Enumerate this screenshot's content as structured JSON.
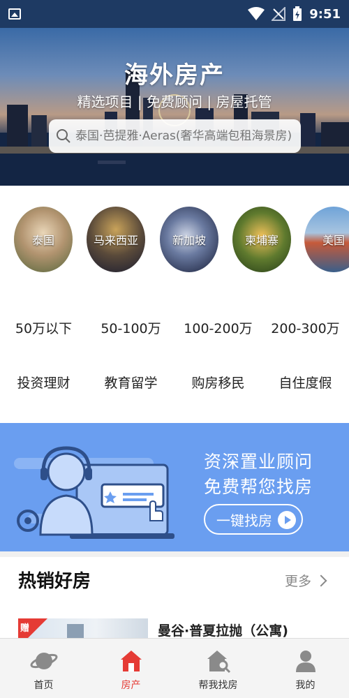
{
  "status_bar": {
    "time": "9:51",
    "icons": [
      "image-icon",
      "wifi-icon",
      "no-signal-icon",
      "battery-charging-icon"
    ]
  },
  "hero": {
    "title": "海外房产",
    "subtitle": "精选项目 | 免费顾问 | 房屋托管",
    "search_placeholder": "泰国·芭提雅·Aeras(奢华高端包租海景房)"
  },
  "countries": [
    {
      "label": "泰国"
    },
    {
      "label": "马来西亚"
    },
    {
      "label": "新加坡"
    },
    {
      "label": "柬埔寨"
    },
    {
      "label": "美国"
    }
  ],
  "price_filters": [
    "50万以下",
    "50-100万",
    "100-200万",
    "200-300万"
  ],
  "topic_filters": [
    "投资理财",
    "教育留学",
    "购房移民",
    "自住度假"
  ],
  "banner": {
    "line1": "资深置业顾问",
    "line2": "免费帮您找房",
    "button": "一键找房"
  },
  "hot_section": {
    "title": "热销好房",
    "more": "更多",
    "listing": {
      "badge": "赠",
      "title": "曼谷·普夏拉抛（公寓)"
    }
  },
  "bottom_nav": [
    {
      "label": "首页",
      "icon": "planet-icon",
      "active": false
    },
    {
      "label": "房产",
      "icon": "house-icon",
      "active": true
    },
    {
      "label": "帮我找房",
      "icon": "find-house-icon",
      "active": false
    },
    {
      "label": "我的",
      "icon": "user-icon",
      "active": false
    }
  ],
  "colors": {
    "accent": "#e53b35",
    "banner": "#6a9ef0",
    "status_bar": "#1e3a63"
  }
}
